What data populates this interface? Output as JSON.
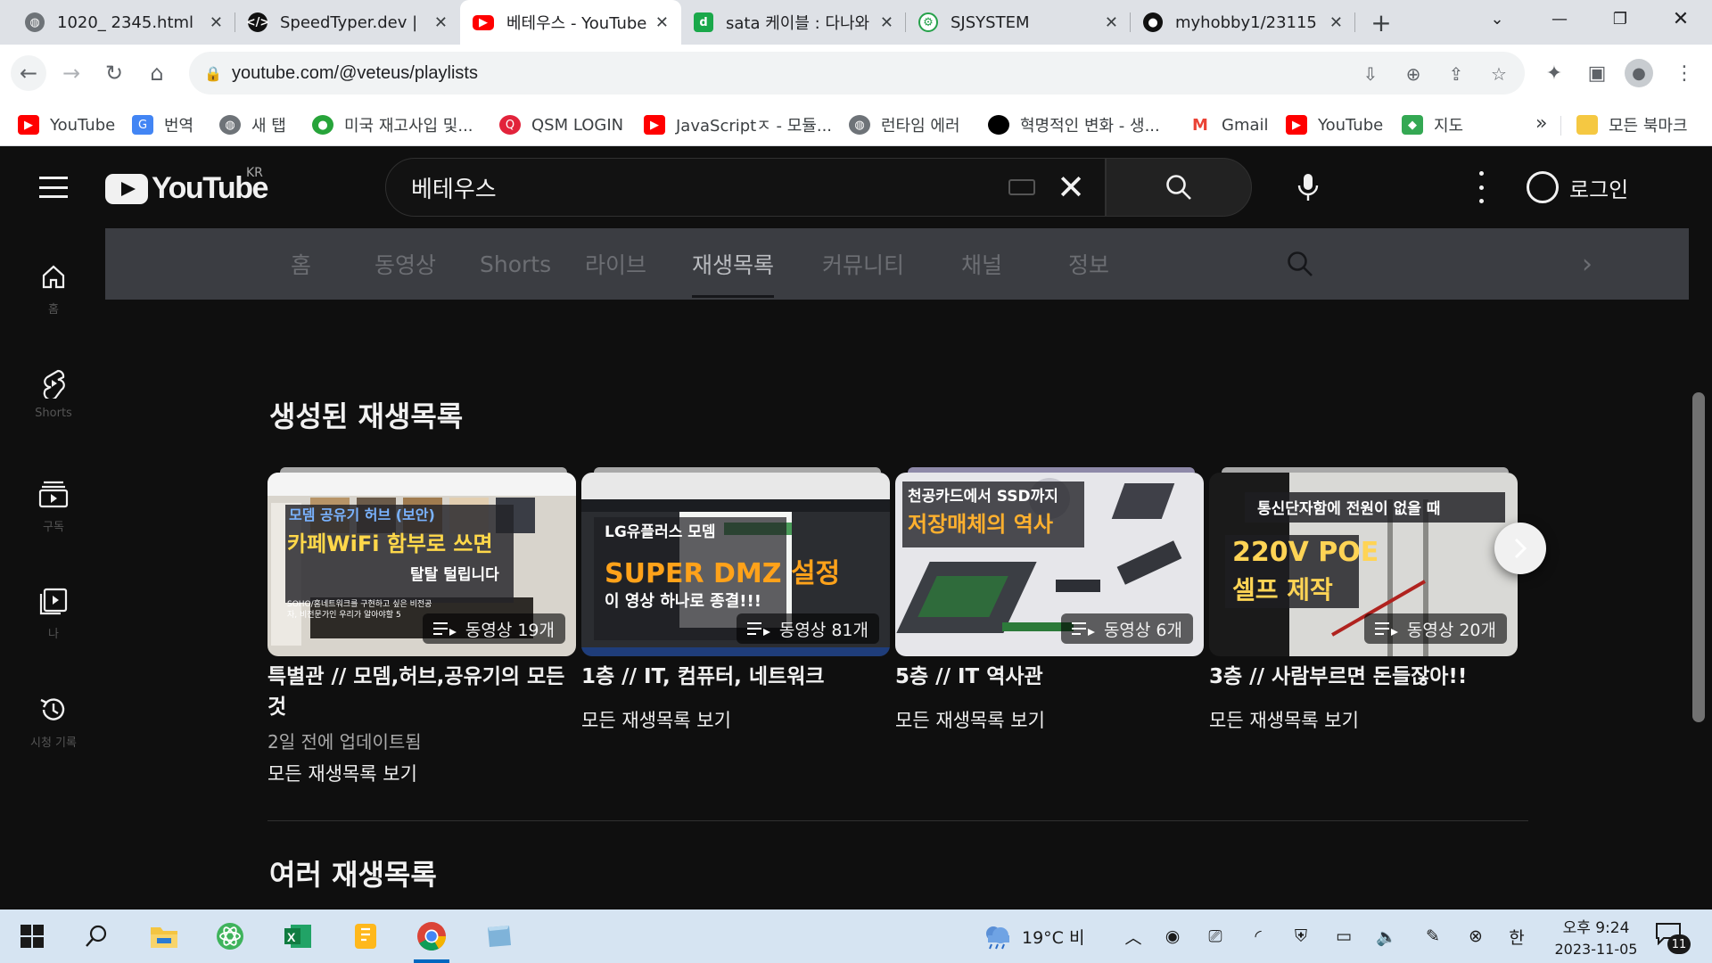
{
  "browser": {
    "tabs": [
      {
        "title": "1020_ 2345.html",
        "active": false
      },
      {
        "title": "SpeedTyper.dev |",
        "active": false
      },
      {
        "title": "베테우스 - YouTube",
        "active": true
      },
      {
        "title": "sata 케이블 : 다나와",
        "active": false
      },
      {
        "title": "SJSYSTEM",
        "active": false
      },
      {
        "title": "myhobby1/23115",
        "active": false
      }
    ],
    "url": "youtube.com/@veteus/playlists",
    "bookmarks": [
      {
        "label": "YouTube",
        "icon": "youtube-icon"
      },
      {
        "label": "번역",
        "icon": "translate-icon"
      },
      {
        "label": "새 탭",
        "icon": "globe-icon"
      },
      {
        "label": "미국 재고사입 및...",
        "icon": "frog-icon"
      },
      {
        "label": "QSM LOGIN",
        "icon": "qsm-icon"
      },
      {
        "label": "JavaScriptㅈ - 모듈...",
        "icon": "youtube-icon"
      },
      {
        "label": "런타임 에러",
        "icon": "globe-icon"
      },
      {
        "label": "혁명적인 변화 - 생...",
        "icon": "circle-icon"
      },
      {
        "label": "Gmail",
        "icon": "gmail-icon"
      },
      {
        "label": "YouTube",
        "icon": "youtube-icon"
      },
      {
        "label": "지도",
        "icon": "maps-icon"
      }
    ],
    "bookmarks_more": "»",
    "all_bookmarks": "모든 북마크"
  },
  "youtube": {
    "logo_text": "YouTube",
    "region": "KR",
    "search_query": "베테우스",
    "signin_label": "로그인",
    "guide": [
      {
        "label": "홈",
        "icon": "home-icon"
      },
      {
        "label": "Shorts",
        "icon": "shorts-icon"
      },
      {
        "label": "구독",
        "icon": "subscriptions-icon"
      },
      {
        "label": "나",
        "icon": "you-icon"
      },
      {
        "label": "시청 기록",
        "icon": "history-icon"
      }
    ],
    "channel_tabs": [
      {
        "label": "홈",
        "active": false
      },
      {
        "label": "동영상",
        "active": false
      },
      {
        "label": "Shorts",
        "active": false
      },
      {
        "label": "라이브",
        "active": false
      },
      {
        "label": "재생목록",
        "active": true
      },
      {
        "label": "커뮤니티",
        "active": false
      },
      {
        "label": "채널",
        "active": false
      },
      {
        "label": "정보",
        "active": false
      }
    ],
    "section_created": "생성된 재생목록",
    "section_multiple": "여러 재생목록",
    "playlists": [
      {
        "title": "특별관 // 모뎀,허브,공유기의 모든 것",
        "count": "동영상 19개",
        "updated": "2일 전에 업데이트됨",
        "view_all": "모든 재생목록 보기",
        "thumb": {
          "line1": "모뎀 공유기 허브 (보안)",
          "line2": "카페WiFi 함부로 쓰면",
          "line3": "탈탈 털립니다",
          "note": "SOHO/홈네트워크를 구현하고 싶은 비전공자, 비전문가인 우리가 알아야할 5"
        }
      },
      {
        "title": "1층 // IT, 컴퓨터, 네트워크",
        "count": "동영상 81개",
        "updated": "",
        "view_all": "모든 재생목록 보기",
        "thumb": {
          "line1": "LG유플러스 모뎀",
          "line2": "SUPER DMZ 설정",
          "line3": "이 영상 하나로 종결!!!"
        }
      },
      {
        "title": "5층 // IT 역사관",
        "count": "동영상 6개",
        "updated": "",
        "view_all": "모든 재생목록 보기",
        "thumb": {
          "line1": "천공카드에서 SSD까지",
          "line2": "저장매체의 역사"
        }
      },
      {
        "title": "3층 // 사람부르면 돈들잖아!!",
        "count": "동영상 20개",
        "updated": "",
        "view_all": "모든 재생목록 보기",
        "thumb": {
          "line1": "통신단자함에 전원이 없을 때",
          "line2": "220V POE",
          "line3": "셀프 제작"
        }
      }
    ]
  },
  "taskbar": {
    "weather": "19°C 비",
    "ime": "한",
    "time": "오후 9:24",
    "date": "2023-11-05",
    "notifications": "11"
  },
  "colors": {
    "youtube_bg": "#0f0f0f",
    "channel_tabbar": "#3b3d42",
    "taskbar": "#d6e4f2",
    "youtube_red": "#ff0000"
  }
}
